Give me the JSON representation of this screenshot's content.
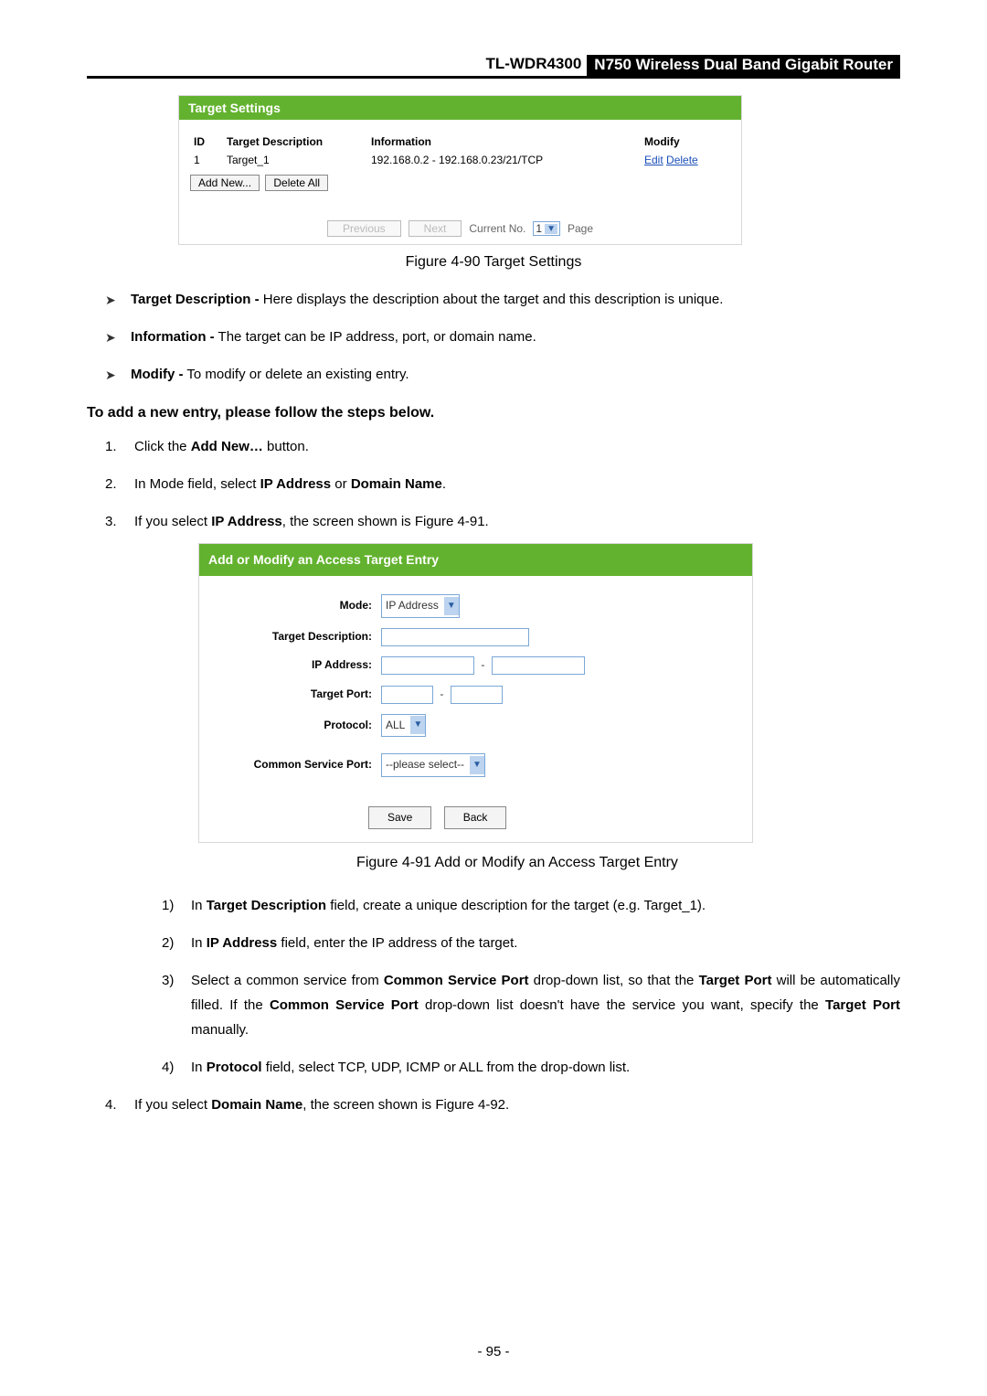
{
  "header": {
    "model": "TL-WDR4300",
    "product": "N750 Wireless Dual Band Gigabit Router"
  },
  "fig90": {
    "title": "Target Settings",
    "cols": {
      "id": "ID",
      "desc": "Target Description",
      "info": "Information",
      "modify": "Modify"
    },
    "rows": [
      {
        "id": "1",
        "desc": "Target_1",
        "info": "192.168.0.2 - 192.168.0.23/21/TCP",
        "edit": "Edit",
        "delete": "Delete"
      }
    ],
    "addNew": "Add New...",
    "deleteAll": "Delete All",
    "prev": "Previous",
    "next": "Next",
    "currentNoLabel": "Current No.",
    "currentNoVal": "1",
    "pageLabel": "Page",
    "caption": "Figure 4-90 Target Settings"
  },
  "bullets": {
    "b1_label": "Target Description -",
    "b1_text": " Here displays the description about the target and this description is unique.",
    "b2_label": "Information -",
    "b2_text": " The target can be IP address, port, or domain name.",
    "b3_label": "Modify -",
    "b3_text": " To modify or delete an existing entry."
  },
  "instr": "To add a new entry, please follow the steps below.",
  "steps": {
    "s1_a": "Click the ",
    "s1_b": "Add New…",
    "s1_c": " button.",
    "s2_a": "In Mode field, select ",
    "s2_b": "IP Address",
    "s2_c": " or ",
    "s2_d": "Domain Name",
    "s2_e": ".",
    "s3_a": "If you select ",
    "s3_b": "IP Address",
    "s3_c": ", the screen shown is Figure 4-91."
  },
  "fig91": {
    "title": "Add or Modify an Access Target Entry",
    "labels": {
      "mode": "Mode:",
      "desc": "Target Description:",
      "ip": "IP Address:",
      "port": "Target Port:",
      "proto": "Protocol:",
      "csp": "Common Service Port:"
    },
    "modeVal": "IP Address",
    "protoVal": "ALL",
    "cspVal": "--please select--",
    "save": "Save",
    "back": "Back",
    "caption": "Figure 4-91 Add or Modify an Access Target Entry"
  },
  "sub": {
    "p1_a": "In ",
    "p1_b": "Target Description",
    "p1_c": " field, create a unique description for the target (e.g. Target_1).",
    "p2_a": "In ",
    "p2_b": "IP Address",
    "p2_c": " field, enter the IP address of the target.",
    "p3_a": "Select a common service from ",
    "p3_b": "Common Service Port",
    "p3_c": " drop-down list, so that the ",
    "p3_d": "Target Port",
    "p3_e": " will be automatically filled. If the ",
    "p3_f": "Common Service Port",
    "p3_g": " drop-down list doesn't have the service you want, specify the ",
    "p3_h": "Target Port",
    "p3_i": " manually.",
    "p4_a": "In ",
    "p4_b": "Protocol",
    "p4_c": " field, select TCP, UDP, ICMP or ALL from the drop-down list."
  },
  "step4": {
    "a": "If you select ",
    "b": "Domain Name",
    "c": ", the screen shown is Figure 4-92."
  },
  "pageNum": "- 95 -"
}
